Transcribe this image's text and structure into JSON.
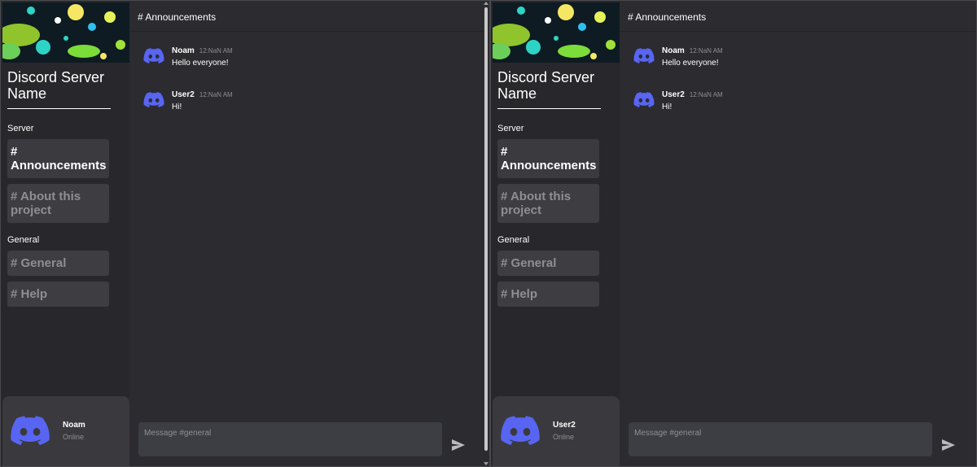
{
  "left": {
    "sidebar": {
      "server_name": "Discord Server Name",
      "section_server": "Server",
      "section_general": "General",
      "channels_server": [
        "# Announcements",
        "# About this project"
      ],
      "channels_general": [
        "# General",
        "# Help"
      ]
    },
    "user": {
      "name": "Noam",
      "status": "Online"
    },
    "topbar": {
      "title": "# Announcements"
    },
    "messages": [
      {
        "author": "Noam",
        "time": "12:NaN AM",
        "text": "Hello everyone!"
      },
      {
        "author": "User2",
        "time": "12:NaN AM",
        "text": "Hi!"
      }
    ],
    "composer": {
      "placeholder": "Message #general"
    }
  },
  "right": {
    "sidebar": {
      "server_name": "Discord Server Name",
      "section_server": "Server",
      "section_general": "General",
      "channels_server": [
        "# Announcements",
        "# About this project"
      ],
      "channels_general": [
        "# General",
        "# Help"
      ]
    },
    "user": {
      "name": "User2",
      "status": "Online"
    },
    "topbar": {
      "title": "# Announcements"
    },
    "messages": [
      {
        "author": "Noam",
        "time": "12:NaN AM",
        "text": "Hello everyone!"
      },
      {
        "author": "User2",
        "time": "12:NaN AM",
        "text": "Hi!"
      }
    ],
    "composer": {
      "placeholder": "Message #general"
    }
  },
  "colors": {
    "blurple": "#5865f2",
    "background": "#2b2b30",
    "sidebar": "#28282c"
  },
  "icons": {
    "avatar": "discord-logo-icon",
    "send": "send-arrow-icon"
  }
}
